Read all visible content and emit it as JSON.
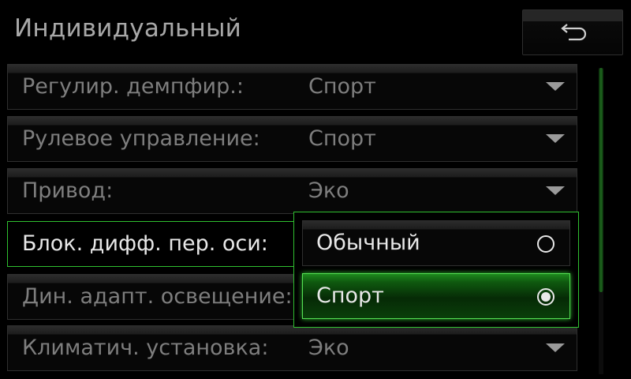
{
  "header": {
    "title": "Индивидуальный",
    "back_icon": "back-arrow-icon"
  },
  "settings": {
    "rows": [
      {
        "label": "Регулир. демпфир.:",
        "value": "Спорт"
      },
      {
        "label": "Рулевое управление:",
        "value": "Спорт"
      },
      {
        "label": "Привод:",
        "value": "Эко"
      },
      {
        "label": "Блок. дифф. пер. оси:",
        "value": ""
      },
      {
        "label": "Дин. адапт. освещение:",
        "value": ""
      },
      {
        "label": "Климатич. установка:",
        "value": "Эко"
      }
    ],
    "selected_index": 3
  },
  "dropdown": {
    "options": [
      {
        "label": "Обычный",
        "checked": false
      },
      {
        "label": "Спорт",
        "checked": true
      }
    ]
  },
  "colors": {
    "accent": "#2fbf2f",
    "background": "#000000",
    "text_dim": "#7e7e7e",
    "text_bright": "#e8e8e8"
  }
}
